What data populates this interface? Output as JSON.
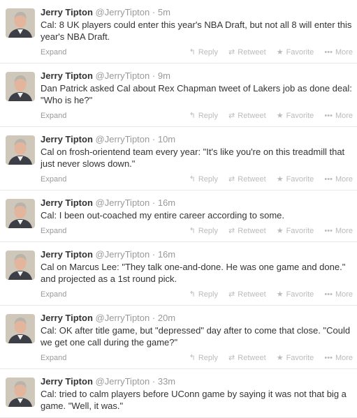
{
  "tweets": [
    {
      "name": "Jerry Tipton",
      "handle": "@JerryTipton",
      "time": "5m",
      "text": "Cal: 8 UK players could enter this year's NBA Draft, but not all 8 will enter this year's NBA Draft.",
      "expand": "Expand"
    },
    {
      "name": "Jerry Tipton",
      "handle": "@JerryTipton",
      "time": "9m",
      "text": "Dan Patrick asked Cal about Rex Chapman tweet of Lakers job as done deal: \"Who is he?\"",
      "expand": "Expand"
    },
    {
      "name": "Jerry Tipton",
      "handle": "@JerryTipton",
      "time": "10m",
      "text": "Cal on frosh-orientend team every year: \"It's like you're on this treadmill that just never slows down.\"",
      "expand": "Expand"
    },
    {
      "name": "Jerry Tipton",
      "handle": "@JerryTipton",
      "time": "16m",
      "text": "Cal: I been out-coached my entire career according to some.",
      "expand": "Expand"
    },
    {
      "name": "Jerry Tipton",
      "handle": "@JerryTipton",
      "time": "16m",
      "text": "Cal on Marcus Lee: \"They talk one-and-done. He was one game and done.\" and projected as a 1st round pick.",
      "expand": "Expand"
    },
    {
      "name": "Jerry Tipton",
      "handle": "@JerryTipton",
      "time": "20m",
      "text": "Cal: OK after title game, but \"depressed\" day after to come that close. \"Could we get one call during the game?\"",
      "expand": "Expand"
    },
    {
      "name": "Jerry Tipton",
      "handle": "@JerryTipton",
      "time": "33m",
      "text": "Cal: tried to calm players before UConn game by saying it was not that big a game. \"Well, it was.\"",
      "expand": ""
    }
  ],
  "actions": {
    "reply": "Reply",
    "retweet": "Retweet",
    "favorite": "Favorite",
    "more": "More"
  },
  "separator": "·",
  "icons": {
    "reply": "reply-arrow-icon",
    "retweet": "retweet-icon",
    "favorite": "star-icon",
    "more": "ellipsis-icon"
  }
}
